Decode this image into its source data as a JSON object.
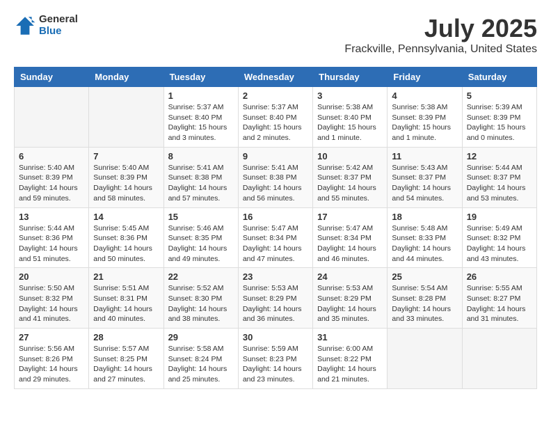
{
  "header": {
    "logo_general": "General",
    "logo_blue": "Blue",
    "title": "July 2025",
    "subtitle": "Frackville, Pennsylvania, United States"
  },
  "calendar": {
    "days_of_week": [
      "Sunday",
      "Monday",
      "Tuesday",
      "Wednesday",
      "Thursday",
      "Friday",
      "Saturday"
    ],
    "weeks": [
      [
        {
          "day": "",
          "info": ""
        },
        {
          "day": "",
          "info": ""
        },
        {
          "day": "1",
          "info": "Sunrise: 5:37 AM\nSunset: 8:40 PM\nDaylight: 15 hours and 3 minutes."
        },
        {
          "day": "2",
          "info": "Sunrise: 5:37 AM\nSunset: 8:40 PM\nDaylight: 15 hours and 2 minutes."
        },
        {
          "day": "3",
          "info": "Sunrise: 5:38 AM\nSunset: 8:40 PM\nDaylight: 15 hours and 1 minute."
        },
        {
          "day": "4",
          "info": "Sunrise: 5:38 AM\nSunset: 8:39 PM\nDaylight: 15 hours and 1 minute."
        },
        {
          "day": "5",
          "info": "Sunrise: 5:39 AM\nSunset: 8:39 PM\nDaylight: 15 hours and 0 minutes."
        }
      ],
      [
        {
          "day": "6",
          "info": "Sunrise: 5:40 AM\nSunset: 8:39 PM\nDaylight: 14 hours and 59 minutes."
        },
        {
          "day": "7",
          "info": "Sunrise: 5:40 AM\nSunset: 8:39 PM\nDaylight: 14 hours and 58 minutes."
        },
        {
          "day": "8",
          "info": "Sunrise: 5:41 AM\nSunset: 8:38 PM\nDaylight: 14 hours and 57 minutes."
        },
        {
          "day": "9",
          "info": "Sunrise: 5:41 AM\nSunset: 8:38 PM\nDaylight: 14 hours and 56 minutes."
        },
        {
          "day": "10",
          "info": "Sunrise: 5:42 AM\nSunset: 8:37 PM\nDaylight: 14 hours and 55 minutes."
        },
        {
          "day": "11",
          "info": "Sunrise: 5:43 AM\nSunset: 8:37 PM\nDaylight: 14 hours and 54 minutes."
        },
        {
          "day": "12",
          "info": "Sunrise: 5:44 AM\nSunset: 8:37 PM\nDaylight: 14 hours and 53 minutes."
        }
      ],
      [
        {
          "day": "13",
          "info": "Sunrise: 5:44 AM\nSunset: 8:36 PM\nDaylight: 14 hours and 51 minutes."
        },
        {
          "day": "14",
          "info": "Sunrise: 5:45 AM\nSunset: 8:36 PM\nDaylight: 14 hours and 50 minutes."
        },
        {
          "day": "15",
          "info": "Sunrise: 5:46 AM\nSunset: 8:35 PM\nDaylight: 14 hours and 49 minutes."
        },
        {
          "day": "16",
          "info": "Sunrise: 5:47 AM\nSunset: 8:34 PM\nDaylight: 14 hours and 47 minutes."
        },
        {
          "day": "17",
          "info": "Sunrise: 5:47 AM\nSunset: 8:34 PM\nDaylight: 14 hours and 46 minutes."
        },
        {
          "day": "18",
          "info": "Sunrise: 5:48 AM\nSunset: 8:33 PM\nDaylight: 14 hours and 44 minutes."
        },
        {
          "day": "19",
          "info": "Sunrise: 5:49 AM\nSunset: 8:32 PM\nDaylight: 14 hours and 43 minutes."
        }
      ],
      [
        {
          "day": "20",
          "info": "Sunrise: 5:50 AM\nSunset: 8:32 PM\nDaylight: 14 hours and 41 minutes."
        },
        {
          "day": "21",
          "info": "Sunrise: 5:51 AM\nSunset: 8:31 PM\nDaylight: 14 hours and 40 minutes."
        },
        {
          "day": "22",
          "info": "Sunrise: 5:52 AM\nSunset: 8:30 PM\nDaylight: 14 hours and 38 minutes."
        },
        {
          "day": "23",
          "info": "Sunrise: 5:53 AM\nSunset: 8:29 PM\nDaylight: 14 hours and 36 minutes."
        },
        {
          "day": "24",
          "info": "Sunrise: 5:53 AM\nSunset: 8:29 PM\nDaylight: 14 hours and 35 minutes."
        },
        {
          "day": "25",
          "info": "Sunrise: 5:54 AM\nSunset: 8:28 PM\nDaylight: 14 hours and 33 minutes."
        },
        {
          "day": "26",
          "info": "Sunrise: 5:55 AM\nSunset: 8:27 PM\nDaylight: 14 hours and 31 minutes."
        }
      ],
      [
        {
          "day": "27",
          "info": "Sunrise: 5:56 AM\nSunset: 8:26 PM\nDaylight: 14 hours and 29 minutes."
        },
        {
          "day": "28",
          "info": "Sunrise: 5:57 AM\nSunset: 8:25 PM\nDaylight: 14 hours and 27 minutes."
        },
        {
          "day": "29",
          "info": "Sunrise: 5:58 AM\nSunset: 8:24 PM\nDaylight: 14 hours and 25 minutes."
        },
        {
          "day": "30",
          "info": "Sunrise: 5:59 AM\nSunset: 8:23 PM\nDaylight: 14 hours and 23 minutes."
        },
        {
          "day": "31",
          "info": "Sunrise: 6:00 AM\nSunset: 8:22 PM\nDaylight: 14 hours and 21 minutes."
        },
        {
          "day": "",
          "info": ""
        },
        {
          "day": "",
          "info": ""
        }
      ]
    ]
  }
}
